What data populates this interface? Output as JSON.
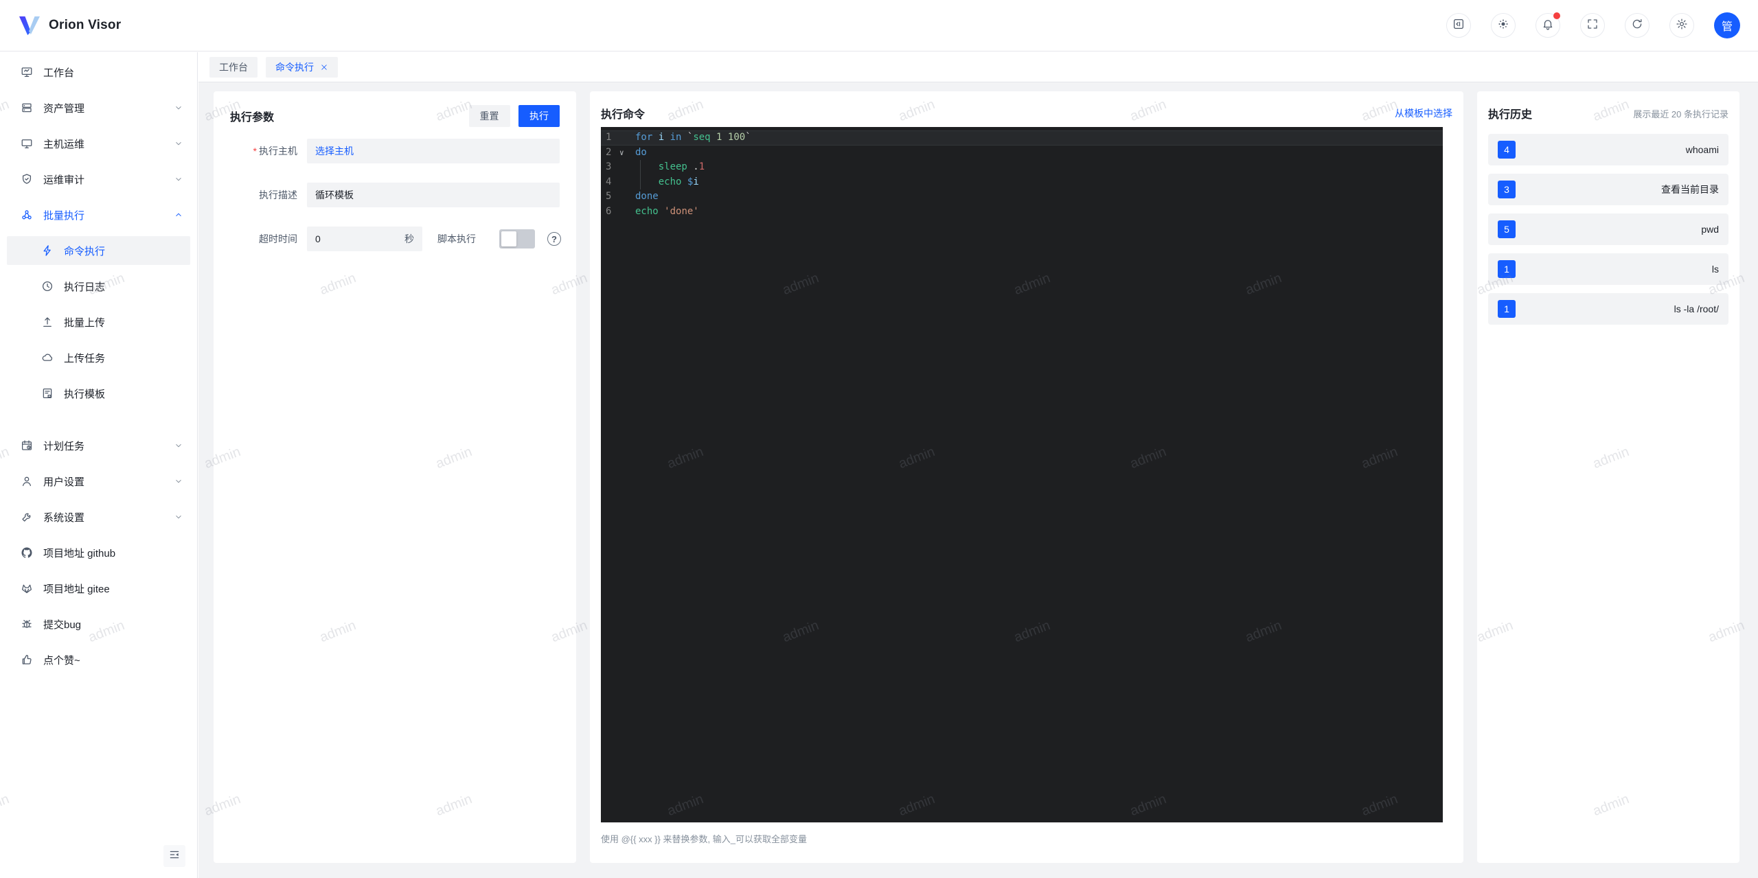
{
  "app": {
    "title": "Orion Visor",
    "avatar_text": "管"
  },
  "tabs": [
    {
      "label": "工作台"
    },
    {
      "label": "命令执行"
    }
  ],
  "sidebar": {
    "items": [
      {
        "label": "工作台"
      },
      {
        "label": "资产管理"
      },
      {
        "label": "主机运维"
      },
      {
        "label": "运维审计"
      },
      {
        "label": "批量执行"
      },
      {
        "label": "命令执行"
      },
      {
        "label": "执行日志"
      },
      {
        "label": "批量上传"
      },
      {
        "label": "上传任务"
      },
      {
        "label": "执行模板"
      },
      {
        "label": "计划任务"
      },
      {
        "label": "用户设置"
      },
      {
        "label": "系统设置"
      },
      {
        "label": "项目地址 github"
      },
      {
        "label": "项目地址 gitee"
      },
      {
        "label": "提交bug"
      },
      {
        "label": "点个赞~"
      }
    ]
  },
  "params_panel": {
    "title": "执行参数",
    "reset_label": "重置",
    "run_label": "执行",
    "required_mark": "*",
    "host_label": "执行主机",
    "host_value": "选择主机",
    "desc_label": "执行描述",
    "desc_value": "循环模板",
    "timeout_label": "超时时间",
    "timeout_value": "0",
    "timeout_suffix": "秒",
    "script_label": "脚本执行",
    "help_mark": "?"
  },
  "command_panel": {
    "title": "执行命令",
    "template_link": "从模板中选择",
    "hint": "使用 @{{ xxx }} 来替换参数, 输入_可以获取全部变量",
    "code": {
      "fold_icon": "∨",
      "colors": {
        "kw": "#569cd6",
        "var": "#9cdcfe",
        "fn": "#44c08e",
        "num": "#b5cea8",
        "num2": "#d16969",
        "str": "#ce9178",
        "plain": "#d4d4d4"
      },
      "lines": [
        {
          "num": "1",
          "highlight": true,
          "tokens": [
            [
              "for ",
              "kw"
            ],
            [
              "i ",
              "var"
            ],
            [
              "in ",
              "kw"
            ],
            [
              "`",
              "plain"
            ],
            [
              "seq ",
              "fn"
            ],
            [
              "1 ",
              "num"
            ],
            [
              "100",
              "num"
            ],
            [
              "`",
              "plain"
            ]
          ]
        },
        {
          "num": "2",
          "fold": true,
          "tokens": [
            [
              "do",
              "kw"
            ]
          ]
        },
        {
          "num": "3",
          "guide": true,
          "tokens": [
            [
              "    ",
              "plain"
            ],
            [
              "sleep ",
              "fn"
            ],
            [
              ".",
              "plain"
            ],
            [
              "1",
              "num2"
            ]
          ]
        },
        {
          "num": "4",
          "guide": true,
          "tokens": [
            [
              "    ",
              "plain"
            ],
            [
              "echo ",
              "fn"
            ],
            [
              "$",
              "kw"
            ],
            [
              "i",
              "var"
            ]
          ]
        },
        {
          "num": "5",
          "tokens": [
            [
              "done",
              "kw"
            ]
          ]
        },
        {
          "num": "6",
          "tokens": [
            [
              "echo ",
              "fn"
            ],
            [
              "'done'",
              "str"
            ]
          ]
        }
      ]
    }
  },
  "history_panel": {
    "title": "执行历史",
    "subtitle": "展示最近 20 条执行记录",
    "items": [
      {
        "count": "4",
        "command": "whoami"
      },
      {
        "count": "3",
        "command": "查看当前目录"
      },
      {
        "count": "5",
        "command": "pwd"
      },
      {
        "count": "1",
        "command": "ls"
      },
      {
        "count": "1",
        "command": "ls -la /root/"
      }
    ]
  },
  "watermark": {
    "text": "admin"
  },
  "colors": {
    "accent": "#165dff",
    "danger": "#f53f3f",
    "editor_bg": "#1e1f21",
    "panel_bg": "#ffffff",
    "page_bg": "#f2f3f5"
  }
}
